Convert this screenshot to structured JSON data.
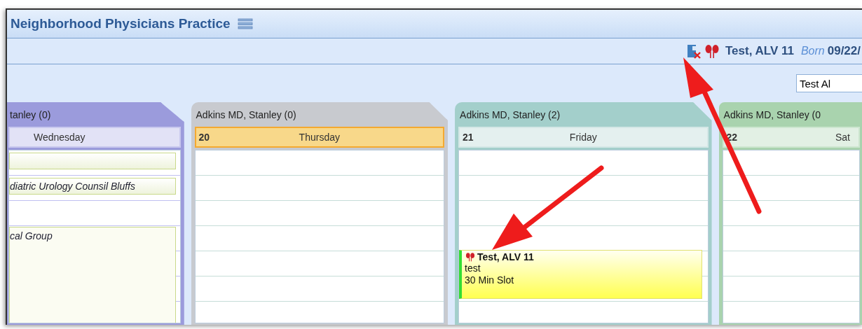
{
  "practice": {
    "title": "Neighborhood Physicians Practice"
  },
  "patient": {
    "name": "Test, ALV 11",
    "born_label": "Born",
    "dob": "09/22/"
  },
  "search": {
    "value": "Test Al"
  },
  "columns": [
    {
      "provider": "tanley (0)",
      "day": "Wednesday",
      "color": "#9b9bdc",
      "today": false,
      "items": [
        {
          "kind": "note"
        },
        {
          "kind": "note",
          "text": "diatric Urology Counsil Bluffs"
        },
        {
          "kind": "block",
          "text": "cal Group"
        }
      ]
    },
    {
      "provider": "Adkins MD, Stanley (0)",
      "day_number": "20",
      "day": "Thursday",
      "color": "#c8cacf",
      "today": true
    },
    {
      "provider": "Adkins MD, Stanley (2)",
      "day_number": "21",
      "day": "Friday",
      "color": "#a3cfcb",
      "today": false,
      "items": [
        {
          "kind": "appointment",
          "patient": "Test, ALV 11",
          "reason": "test",
          "slot": "30 Min Slot"
        }
      ]
    },
    {
      "provider": "Adkins MD, Stanley (0",
      "day_number": "22",
      "day": "Sat",
      "color": "#a9d3ae",
      "today": false
    }
  ]
}
